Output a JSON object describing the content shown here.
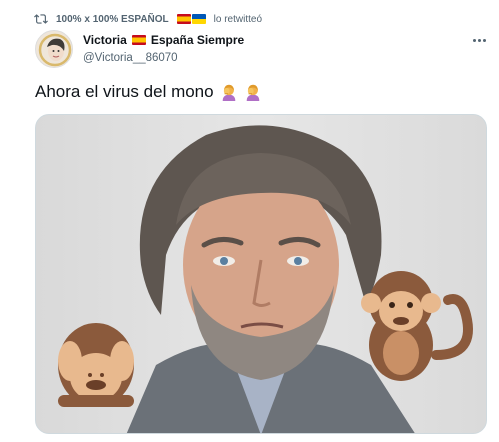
{
  "retweet": {
    "icon": "retweet-icon",
    "account": "100% x 100% ESPAÑOL",
    "suffix": "lo retwitteó"
  },
  "tweet": {
    "author_name": "Victoria",
    "author_name_suffix": "España Siempre",
    "handle": "@Victoria__86070",
    "text": "Ahora el virus del mono",
    "text_emojis": [
      "woman-facepalming-emoji",
      "woman-facepalming-emoji"
    ],
    "media": {
      "description_icon_left": "see-no-evil-monkey-emoji",
      "description_icon_right": "monkey-emoji"
    }
  },
  "colors": {
    "text_primary": "#0f1419",
    "text_secondary": "#536471",
    "border": "#cfd9de"
  }
}
